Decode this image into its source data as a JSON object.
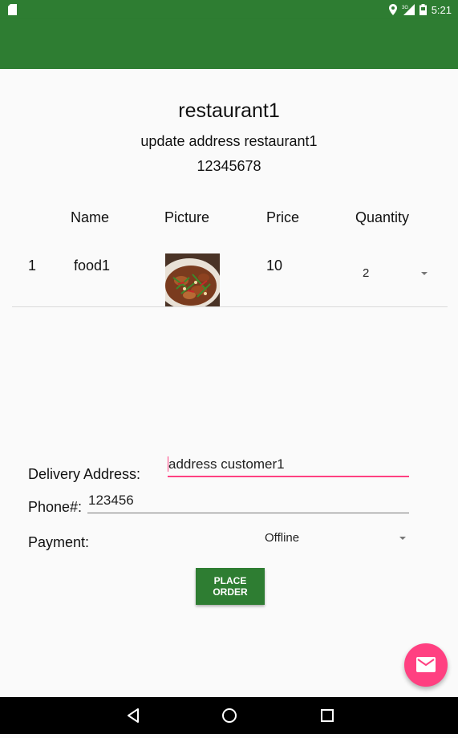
{
  "status_bar": {
    "time": "5:21",
    "network": "3G"
  },
  "restaurant": {
    "name": "restaurant1",
    "address": "update address restaurant1",
    "phone": "12345678"
  },
  "table": {
    "headers": [
      "Name",
      "Picture",
      "Price",
      "Quantity"
    ],
    "rows": [
      {
        "index": "1",
        "name": "food1",
        "price": "10",
        "quantity": "2"
      }
    ]
  },
  "form": {
    "delivery_label": "Delivery Address:",
    "delivery_value": "address customer1",
    "phone_label": "Phone#:",
    "phone_value": "123456",
    "payment_label": "Payment:",
    "payment_value": "Offline"
  },
  "actions": {
    "place_order": "PLACE ORDER"
  },
  "colors": {
    "primary": "#2e7d32",
    "accent": "#ff4081",
    "background": "#fafafa"
  },
  "icons": [
    "sd-card-icon",
    "location-icon",
    "signal-icon",
    "battery-icon",
    "mail-icon",
    "back-icon",
    "home-icon",
    "recents-icon"
  ]
}
